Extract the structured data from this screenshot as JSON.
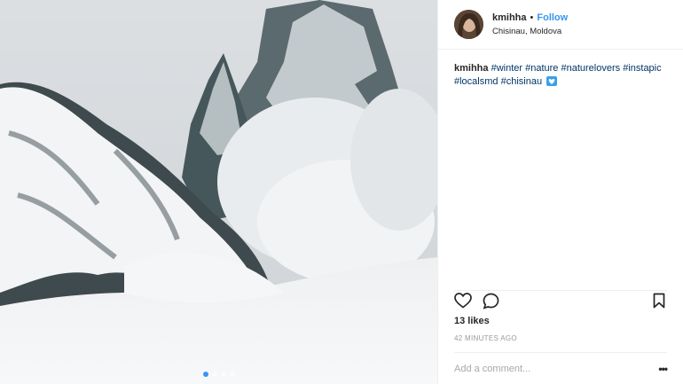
{
  "post": {
    "username": "kmihha",
    "separator": "•",
    "follow_label": "Follow",
    "location": "Chisinau, Moldova",
    "caption": {
      "username": "kmihha",
      "tags": [
        "#winter",
        "#nature",
        "#naturelovers",
        "#instapic",
        "#localsmd",
        "#chisinau"
      ],
      "emoji": "blue-heart-emoji"
    },
    "likes_text": "13 likes",
    "time_text": "42 MINUTES AGO",
    "comment_placeholder": "Add a comment...",
    "more_label": "•••",
    "carousel": {
      "count": 4,
      "active_index": 0
    },
    "colors": {
      "accent": "#3897f0",
      "hashtag": "#003569",
      "muted": "#999999"
    },
    "icons": [
      "heart-icon",
      "comment-icon",
      "bookmark-icon",
      "more-options-icon"
    ]
  }
}
